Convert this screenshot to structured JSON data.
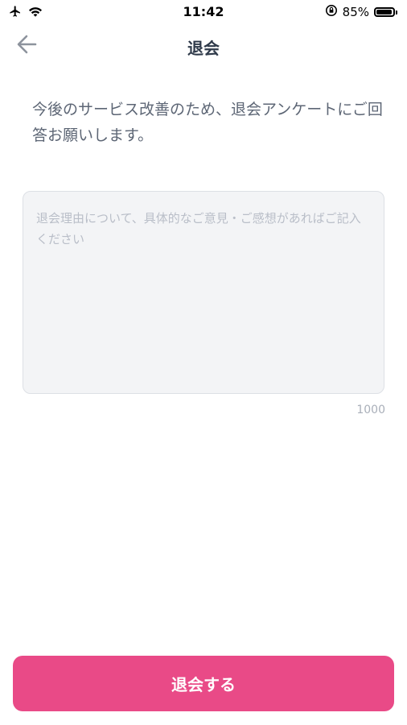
{
  "status_bar": {
    "time": "11:42",
    "battery": "85%",
    "battery_level": 0.85,
    "icons": [
      "airplane-icon",
      "wifi-icon",
      "orientation-lock-icon",
      "battery-icon"
    ]
  },
  "nav": {
    "back_icon": "arrow-left-icon",
    "title": "退会"
  },
  "intro": {
    "text": "今後のサービス改善のため、退会アンケートにご回答お願いします。"
  },
  "reason": {
    "placeholder": "退会理由について、具体的なご意見・ご感想があればご記入ください",
    "value": "",
    "max_length": "1000"
  },
  "actions": {
    "withdraw_label": "退会する"
  },
  "colors": {
    "accent": "#e94a87",
    "field_bg": "#f3f4f6",
    "text_primary": "#2f3a4a",
    "text_secondary": "#5d6675"
  }
}
